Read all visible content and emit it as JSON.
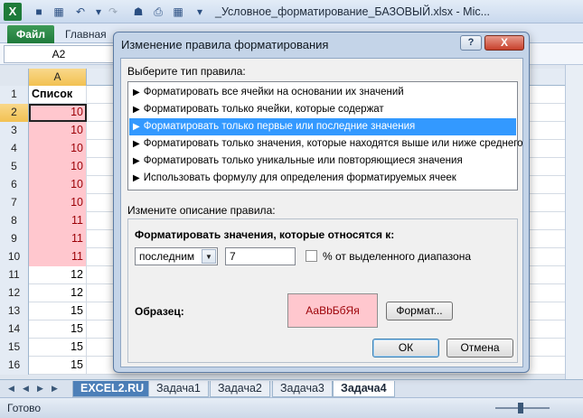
{
  "app": {
    "logo_letter": "X",
    "title": "_Условное_форматирование_БАЗОВЫЙ.xlsx - Mic..."
  },
  "ribbon": {
    "file_tab": "Файл",
    "home_tab": "Главная"
  },
  "name_box": "A2",
  "grid": {
    "column_header": "A",
    "rows": [
      {
        "num": "1",
        "value": "Список",
        "style": "header"
      },
      {
        "num": "2",
        "value": "10",
        "style": "pink"
      },
      {
        "num": "3",
        "value": "10",
        "style": "pink"
      },
      {
        "num": "4",
        "value": "10",
        "style": "pink"
      },
      {
        "num": "5",
        "value": "10",
        "style": "pink"
      },
      {
        "num": "6",
        "value": "10",
        "style": "pink"
      },
      {
        "num": "7",
        "value": "10",
        "style": "pink"
      },
      {
        "num": "8",
        "value": "11",
        "style": "pink"
      },
      {
        "num": "9",
        "value": "11",
        "style": "pink"
      },
      {
        "num": "10",
        "value": "11",
        "style": "pink"
      },
      {
        "num": "11",
        "value": "12",
        "style": "plain"
      },
      {
        "num": "12",
        "value": "12",
        "style": "plain"
      },
      {
        "num": "13",
        "value": "15",
        "style": "plain"
      },
      {
        "num": "14",
        "value": "15",
        "style": "plain"
      },
      {
        "num": "15",
        "value": "15",
        "style": "plain"
      },
      {
        "num": "16",
        "value": "15",
        "style": "plain"
      }
    ]
  },
  "sheet_tabs": [
    "EXCEL2.RU",
    "Задача1",
    "Задача2",
    "Задача3",
    "Задача4"
  ],
  "status": {
    "text": "Готово"
  },
  "dialog": {
    "title": "Изменение правила форматирования",
    "help": "?",
    "close": "X",
    "rule_type_label": "Выберите тип правила:",
    "rule_types": [
      "Форматировать все ячейки на основании их значений",
      "Форматировать только ячейки, которые содержат",
      "Форматировать только первые или последние значения",
      "Форматировать только значения, которые находятся выше или ниже среднего",
      "Форматировать только уникальные или повторяющиеся значения",
      "Использовать формулу для определения форматируемых ячеек"
    ],
    "selected_rule_index": 2,
    "description_label": "Измените описание правила:",
    "format_values_label": "Форматировать значения, которые относятся к:",
    "rank_select": "последним",
    "rank_value": "7",
    "percent_label": "% от выделенного диапазона",
    "sample_label": "Образец:",
    "sample_text": "АаВbБбЯя",
    "format_button": "Формат...",
    "ok_button": "ОК",
    "cancel_button": "Отмена"
  },
  "colors": {
    "highlight_fill": "#ffc7ce",
    "highlight_text": "#9c0006",
    "selection": "#3399ff"
  }
}
